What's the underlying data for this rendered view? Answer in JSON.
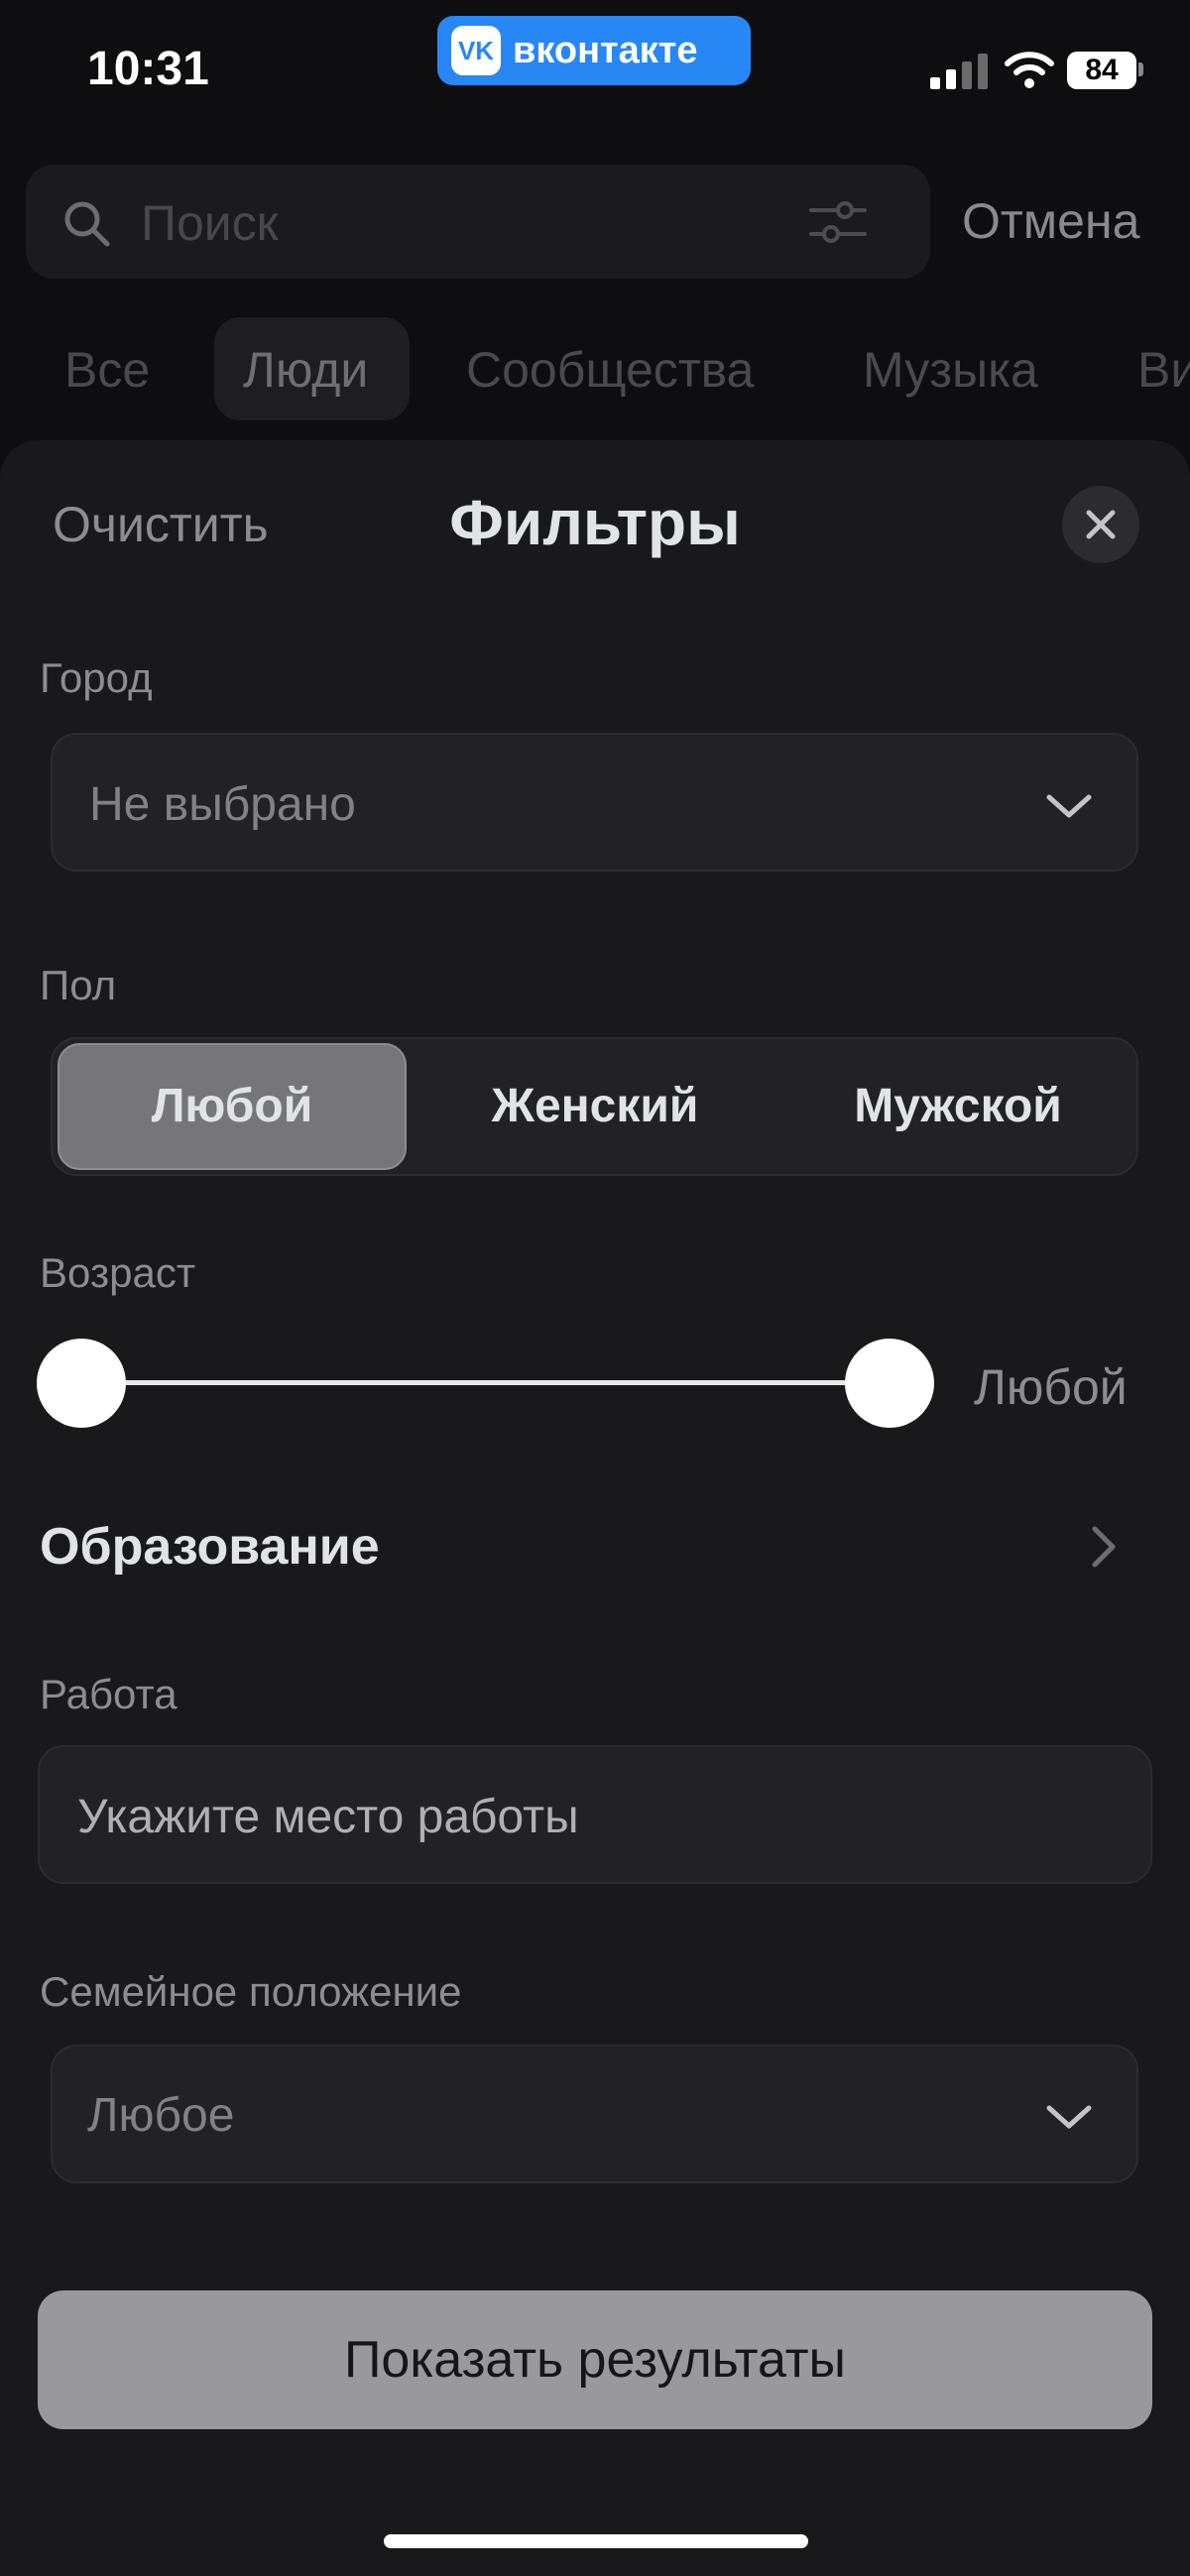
{
  "status_bar": {
    "time": "10:31",
    "app_badge": "вконтакте",
    "app_logo": "VK",
    "battery": "84"
  },
  "search": {
    "placeholder": "Поиск",
    "cancel": "Отмена"
  },
  "tabs": [
    {
      "label": "Все",
      "active": false
    },
    {
      "label": "Люди",
      "active": true
    },
    {
      "label": "Сообщества",
      "active": false
    },
    {
      "label": "Музыка",
      "active": false
    },
    {
      "label": "Ви",
      "active": false
    }
  ],
  "sheet": {
    "clear": "Очистить",
    "title": "Фильтры",
    "city": {
      "label": "Город",
      "value": "Не выбрано"
    },
    "gender": {
      "label": "Пол",
      "options": [
        "Любой",
        "Женский",
        "Мужской"
      ],
      "selected": "Любой"
    },
    "age": {
      "label": "Возраст",
      "value": "Любой"
    },
    "education": {
      "label": "Образование"
    },
    "work": {
      "label": "Работа",
      "placeholder": "Укажите место работы"
    },
    "family": {
      "label": "Семейное положение",
      "value": "Любое"
    },
    "submit": "Показать результаты"
  },
  "colors": {
    "accent": "#2787f5",
    "background": "#0e0e10",
    "sheet": "#19191b"
  }
}
